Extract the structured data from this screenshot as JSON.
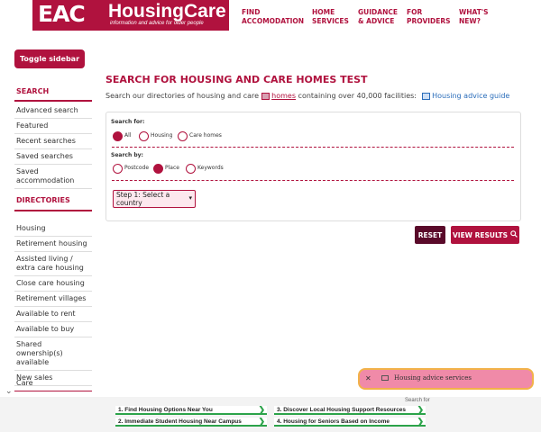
{
  "brand": {
    "logo_mark": "EAC",
    "name": "HousingCare",
    "tagline": "information and advice for older people"
  },
  "nav": [
    {
      "line1": "FIND",
      "line2": "ACCOMODATION"
    },
    {
      "line1": "HOME",
      "line2": "SERVICES"
    },
    {
      "line1": "GUIDANCE",
      "line2": "& ADVICE"
    },
    {
      "line1": "FOR",
      "line2": "PROVIDERS"
    },
    {
      "line1": "WHAT'S",
      "line2": "NEW?"
    }
  ],
  "toggle_label": "Toggle sidebar",
  "sidebar": {
    "search_heading": "SEARCH",
    "search_items": [
      "Advanced search",
      "Featured",
      "Recent searches",
      "Saved searches",
      "Saved accommodation"
    ],
    "directories_heading": "DIRECTORIES",
    "directory_items": [
      "Housing",
      "Retirement housing",
      "Assisted living / extra care housing",
      "Close care housing",
      "Retirement villages",
      "Available to rent",
      "Available to buy",
      "Shared ownership(s) available",
      "New sales"
    ],
    "care_heading": "Care"
  },
  "main": {
    "title": "SEARCH FOR HOUSING AND CARE HOMES TEST",
    "intro_prefix": "Search our directories of housing and care",
    "intro_link": "homes",
    "intro_suffix": "containing over 40,000 facilities:",
    "guide_link": "Housing advice guide",
    "search_for_label": "Search for:",
    "search_for_options": [
      "All",
      "Housing",
      "Care homes"
    ],
    "search_by_label": "Search by:",
    "search_by_options": [
      "Postcode",
      "Place",
      "Keywords"
    ],
    "country_select": "Step 1: Select a country",
    "reset_label": "RESET",
    "view_results_label": "VIEW RESULTS"
  },
  "toast": {
    "text": "Housing advice services"
  },
  "ads": {
    "label": "Search for",
    "items": [
      "1. Find Housing Options Near You",
      "3. Discover Local Housing Support Resources",
      "2. Immediate Student Housing Near Campus",
      "4. Housing for Seniors Based on Income"
    ]
  },
  "colors": {
    "accent": "#b0123e",
    "dark_button": "#5a0a2a",
    "ad_green": "#2ca34a"
  }
}
